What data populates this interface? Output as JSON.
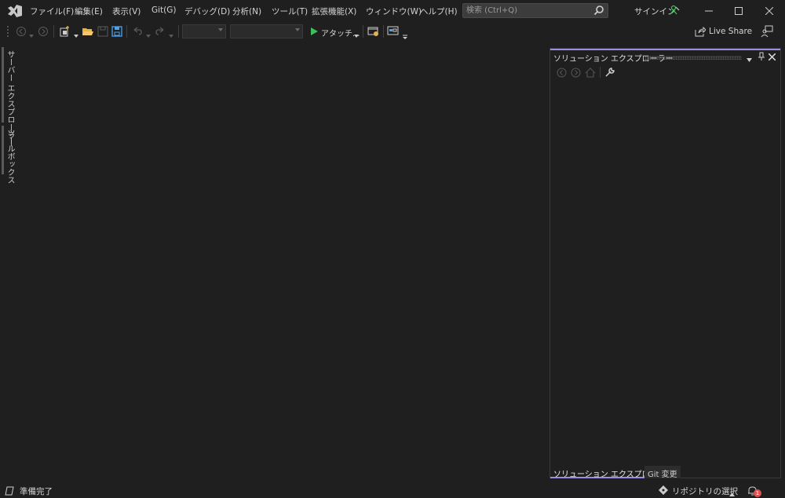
{
  "menu": {
    "items": [
      "ファイル(F)",
      "編集(E)",
      "表示(V)",
      "Git(G)",
      "デバッグ(D)",
      "分析(N)",
      "ツール(T)",
      "拡張機能(X)",
      "ウィンドウ(W)",
      "ヘルプ(H)"
    ]
  },
  "search": {
    "placeholder": "検索 (Ctrl+Q)"
  },
  "account": {
    "signin_label": "サインイン"
  },
  "toolbar": {
    "attach_label": "アタッチ...",
    "live_share_label": "Live Share"
  },
  "side_tabs": {
    "server_explorer": "サーバー エクスプローラー",
    "toolbox": "ツールボックス"
  },
  "solution_explorer": {
    "title": "ソリューション エクスプローラー"
  },
  "bottom_tabs": {
    "solution_explorer": "ソリューション エクスプローラー",
    "git_changes": "Git 変更"
  },
  "status": {
    "ready": "準備完了",
    "repository": "リポジトリの選択",
    "notification_count": "1"
  },
  "colors": {
    "accent": "#9d8ce6",
    "play": "#3dbf5a",
    "folder": "#e8b24a",
    "save": "#4aa3f0",
    "badge": "#e05252"
  }
}
